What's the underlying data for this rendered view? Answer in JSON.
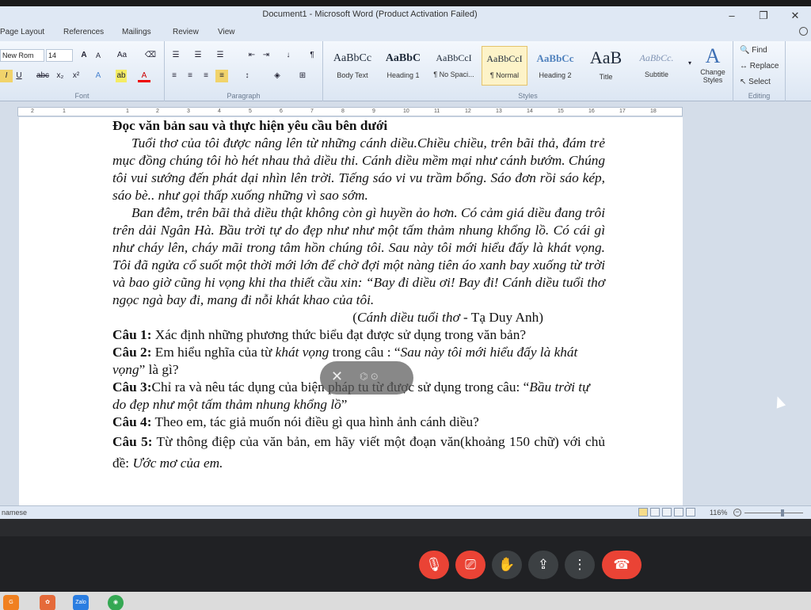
{
  "window": {
    "title": "Document1  -  Microsoft Word (Product Activation Failed)",
    "controls": [
      "–",
      "❐",
      "✕"
    ]
  },
  "ribbon_tabs": [
    "Page Layout",
    "References",
    "Mailings",
    "Review",
    "View"
  ],
  "font_group": {
    "font_name": "New Rom",
    "font_size": "14",
    "label": "Font"
  },
  "paragraph_group": {
    "label": "Paragraph"
  },
  "styles_group": {
    "label": "Styles",
    "items": [
      {
        "preview": "AaBbCc",
        "name": "Body Text"
      },
      {
        "preview": "AaBbC",
        "name": "Heading 1"
      },
      {
        "preview": "AaBbCcI",
        "name": "¶ No Spaci..."
      },
      {
        "preview": "AaBbCcI",
        "name": "¶ Normal"
      },
      {
        "preview": "AaBbCc",
        "name": "Heading 2"
      },
      {
        "preview": "AaB",
        "name": "Title"
      },
      {
        "preview": "AaBbCc.",
        "name": "Subtitle"
      }
    ],
    "change_styles": "Change Styles"
  },
  "editing_group": {
    "label": "Editing",
    "find": "Find",
    "replace": "Replace",
    "select": "Select"
  },
  "ruler_numbers": [
    "2",
    "1",
    "1",
    "2",
    "3",
    "4",
    "5",
    "6",
    "7",
    "8",
    "9",
    "10",
    "11",
    "12",
    "13",
    "14",
    "15",
    "16",
    "17",
    "18"
  ],
  "document": {
    "heading": "Đọc văn bản sau và thực hiện yêu cầu bên dưới",
    "para1": "Tuổi thơ của tôi được nâng lên từ những cánh diều.Chiều chiều, trên bãi thả, đám trẻ mục đồng chúng tôi hò hét nhau thả diều thi. Cánh diều mềm mại như cánh bướm. Chúng tôi vui sướng đến phát dại nhìn lên trời. Tiếng sáo vi vu trầm bổng. Sáo đơn rồi sáo kép, sáo bè.. như gọi thấp xuống những vì sao sớm.",
    "para2": "Ban đêm, trên bãi thả diều thật không còn gì huyền ảo hơn. Có cảm giá diều đang trôi trên dải Ngân Hà. Bầu trời tự do đẹp như như một tấm thảm nhung khổng lồ. Có cái gì như cháy lên, cháy mãi trong tâm hồn chúng tôi. Sau này tôi mới hiểu đấy là khát vọng. Tôi đã ngửa cổ suốt một thời mới lớn để chờ đợi một nàng tiên áo xanh bay xuống từ trời và bao giờ cũng hi vọng khi tha thiết cầu xin: “Bay đi diều ơi! Bay đi! Cánh diều tuổi thơ ngọc ngà bay đi, mang đi nỗi khát khao của tôi.",
    "source_title": "Cánh diều tuổi thơ",
    "source_author": " - Tạ Duy Anh)",
    "source_open": "(",
    "q1_label": "Câu 1:",
    "q1_text": "  Xác định những phương thức biểu đạt được sử dụng trong văn bản?",
    "q2_label": "Câu 2:",
    "q2_text_a": " Em hiểu nghĩa của từ ",
    "q2_word": "khát vọng",
    "q2_text_b": " trong câu : “",
    "q2_quote": "Sau này tôi mới hiểu đấy là khát vọng",
    "q2_text_c": "” là gì?",
    "q3_label": "Câu 3:",
    "q3_text": "Chỉ ra và nêu tác dụng của biện pháp tu từ được sử dụng trong câu: “",
    "q3_quote": "Bầu trời tự do đẹp như một tấm thảm nhung khổng lồ",
    "q3_end": "”",
    "q4_label": "Câu 4:",
    "q4_text": " Theo em, tác giả muốn nói điều gì qua hình ảnh cánh diều?",
    "q5_label": "Câu 5:",
    "q5_text": " Từ thông điệp của văn bản, em hãy viết một đoạn văn(khoảng 150 chữ) với chủ đề: ",
    "q5_topic": "Ước mơ của em."
  },
  "status": {
    "language": "namese",
    "zoom": "116%"
  },
  "meet_controls": [
    "mic-off",
    "camera-off",
    "raise-hand",
    "present",
    "more",
    "end-call"
  ],
  "taskbar": [
    "G",
    "✿",
    "Zalo",
    "◉"
  ]
}
